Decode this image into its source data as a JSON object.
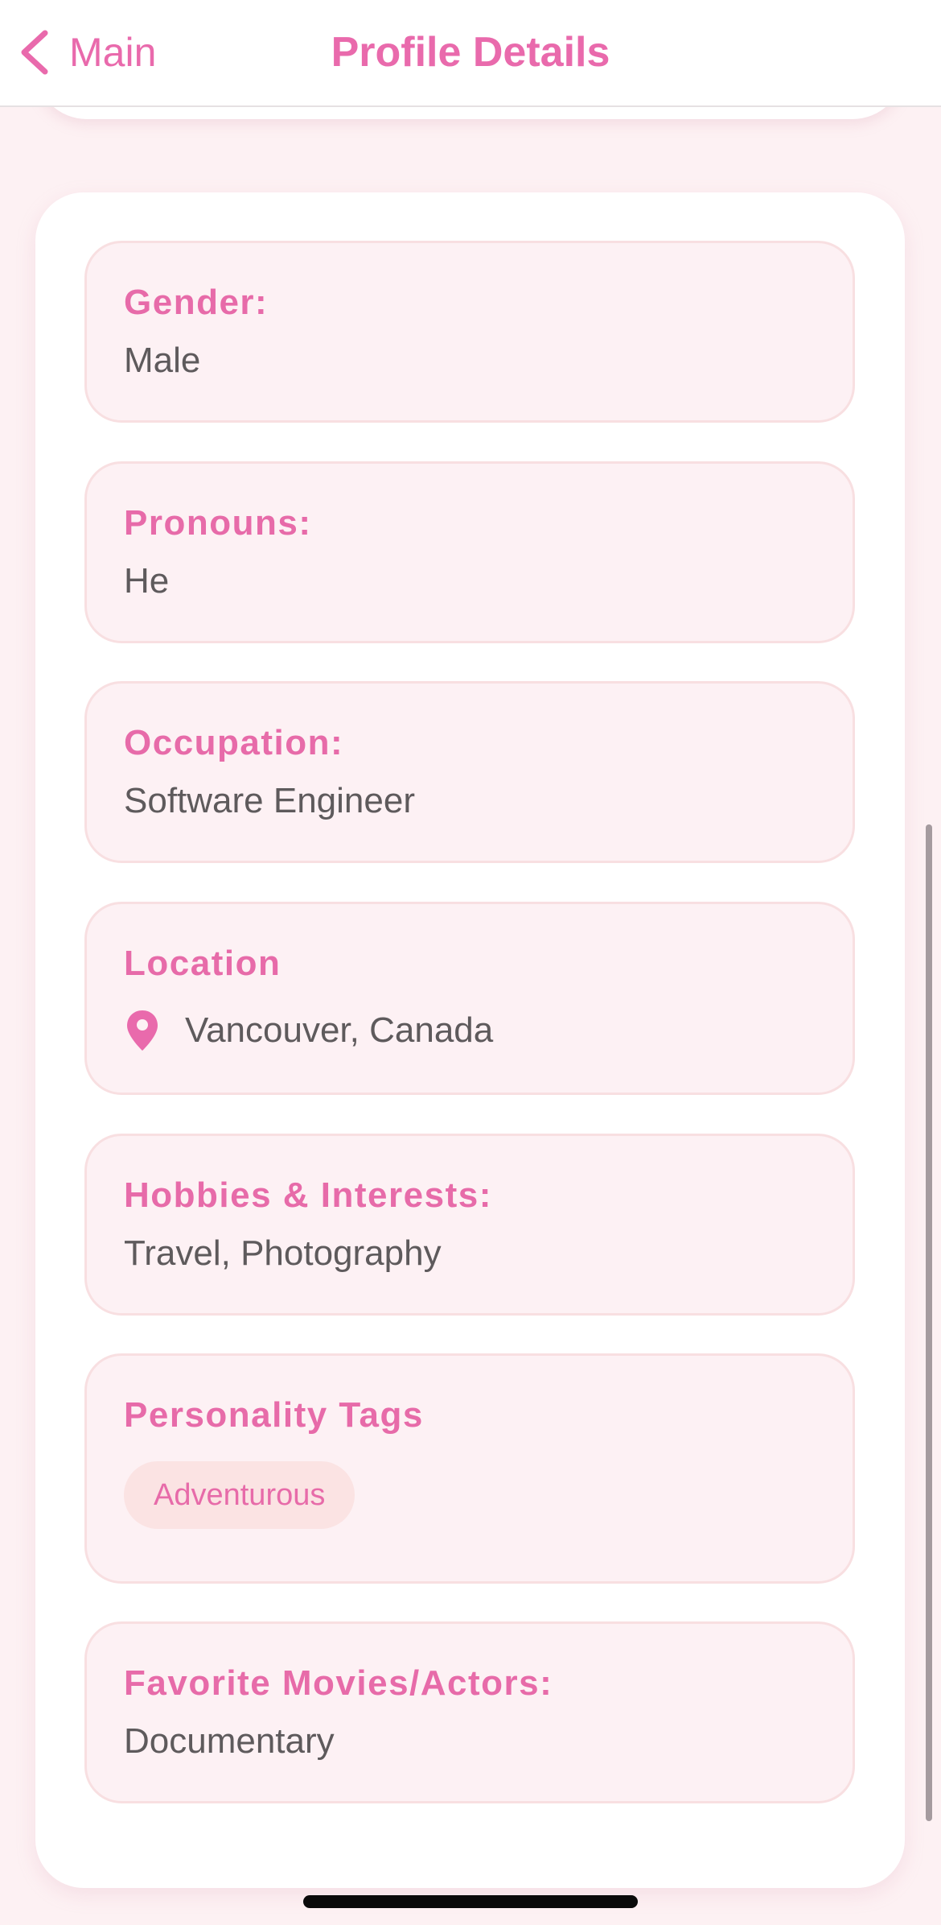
{
  "nav": {
    "back_label": "Main",
    "title": "Profile Details"
  },
  "fields": {
    "gender": {
      "label": "Gender:",
      "value": "Male"
    },
    "pronouns": {
      "label": "Pronouns:",
      "value": "He"
    },
    "occupation": {
      "label": "Occupation:",
      "value": "Software Engineer"
    },
    "location": {
      "label": "Location",
      "value": "Vancouver, Canada",
      "icon": "map-pin-icon"
    },
    "hobbies": {
      "label": "Hobbies & Interests:",
      "value": "Travel, Photography"
    },
    "personality": {
      "label": "Personality Tags",
      "tags": [
        "Adventurous"
      ]
    },
    "movies": {
      "label": "Favorite Movies/Actors:",
      "value": "Documentary"
    }
  },
  "colors": {
    "accent": "#e96aac",
    "background": "#fdf1f3",
    "field_background": "#fdf1f4",
    "field_border": "#f8dfe1",
    "tag_background": "#fbe3e3",
    "value_text": "#5e5a5c"
  }
}
